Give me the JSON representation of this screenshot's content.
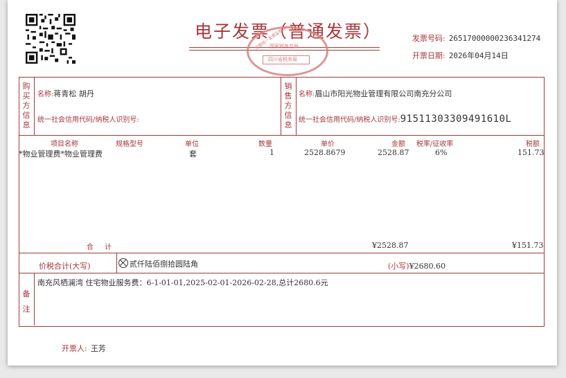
{
  "header": {
    "title": "电子发票（普通发票）",
    "invoice_number_label": "发票号码:",
    "invoice_number": "26517000000236341274",
    "issue_date_label": "开票日期:",
    "issue_date": "2026年04月14日"
  },
  "seal": {
    "arc_text": "全国统一发票监制章",
    "middle_text": "国家税务总局",
    "bar_text": "四川省税务局"
  },
  "buyer": {
    "section_label": [
      "购",
      "买",
      "方",
      "信",
      "息"
    ],
    "name_label": "名称:",
    "name": "蒋青松 胡丹",
    "taxid_label": "统一社会信用代码/纳税人识别号:",
    "taxid": ""
  },
  "seller": {
    "section_label": [
      "销",
      "售",
      "方",
      "信",
      "息"
    ],
    "name_label": "名称:",
    "name": "眉山市阳光物业管理有限公司南充分公司",
    "taxid_label": "统一社会信用代码/纳税人识别号:",
    "taxid": "91511303309491610L"
  },
  "items": {
    "columns": {
      "name": "项目名称",
      "spec": "规格型号",
      "unit": "单位",
      "qty": "数量",
      "price": "单价",
      "amount": "金额",
      "rate": "税率/征收率",
      "tax": "税额"
    },
    "rows": [
      {
        "name": "*物业管理费*物业管理费",
        "spec": "",
        "unit": "套",
        "qty": "1",
        "price": "2528.8679",
        "amount": "2528.87",
        "rate": "6%",
        "tax": "151.73"
      }
    ],
    "total_label": "合　计",
    "total_amount": "¥2528.87",
    "total_tax": "¥151.73"
  },
  "grand_total": {
    "label": "价税合计(大写)",
    "upper": "贰仟陆佰捌拾圆陆角",
    "lower_label": "(小写)",
    "lower": "¥2680.60"
  },
  "remarks": {
    "label": [
      "备",
      "注"
    ],
    "text": "南充风栖澜湾 住宅物业服务费：6-1-01-01,2025-02-01-2026-02-28,总计2680.6元"
  },
  "issuer": {
    "label": "开票人:",
    "name": "王芳"
  },
  "colors": {
    "accent": "#a8353a",
    "seal": "#d98080",
    "text": "#333333"
  }
}
